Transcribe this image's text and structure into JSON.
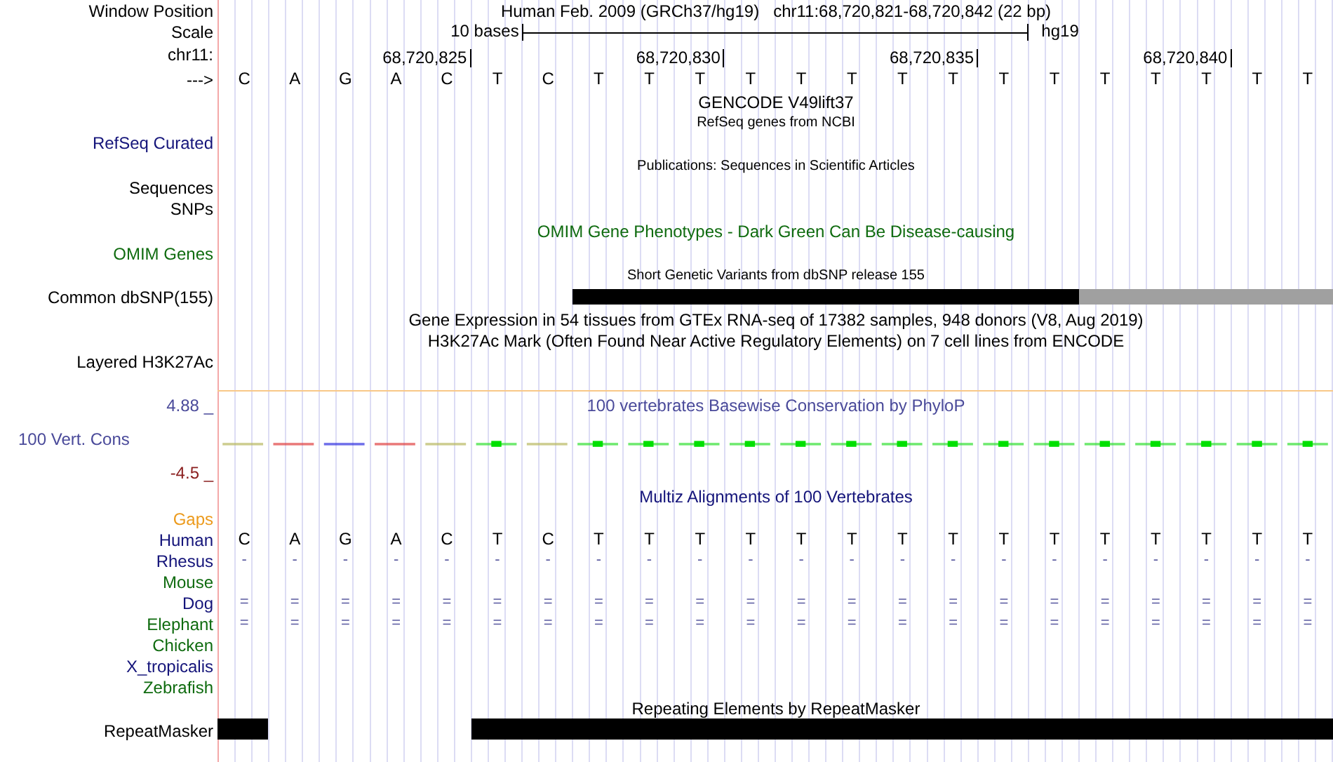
{
  "window_position": {
    "label": "Window Position",
    "text": "Human Feb. 2009 (GRCh37/hg19)   chr11:68,720,821-68,720,842 (22 bp)"
  },
  "scale": {
    "label": "Scale",
    "bar_label": "10 bases",
    "assembly": "hg19"
  },
  "ruler": {
    "label": "chr11:",
    "ticks": [
      "68,720,825",
      "68,720,830",
      "68,720,835",
      "68,720,840"
    ]
  },
  "sequence": {
    "label": "--->",
    "bases": [
      "C",
      "A",
      "G",
      "A",
      "C",
      "T",
      "C",
      "T",
      "T",
      "T",
      "T",
      "T",
      "T",
      "T",
      "T",
      "T",
      "T",
      "T",
      "T",
      "T",
      "T",
      "T"
    ]
  },
  "gencode": {
    "title": "GENCODE V49lift37"
  },
  "refseq": {
    "title": "RefSeq genes from NCBI",
    "label": "RefSeq Curated"
  },
  "publications": {
    "title": "Publications: Sequences in Scientific Articles",
    "label": "Sequences"
  },
  "snps": {
    "label": "SNPs"
  },
  "omim": {
    "title": "OMIM Gene Phenotypes - Dark Green Can Be Disease-causing",
    "label": "OMIM Genes"
  },
  "dbsnp": {
    "title": "Short Genetic Variants from dbSNP release 155",
    "label": "Common dbSNP(155)"
  },
  "gtex": {
    "title": "Gene Expression in 54 tissues from GTEx RNA-seq of 17382 samples, 948 donors (V8, Aug 2019)"
  },
  "h3k27ac": {
    "title": "H3K27Ac Mark (Often Found Near Active Regulatory Elements) on 7 cell lines from ENCODE",
    "label": "Layered H3K27Ac"
  },
  "conservation": {
    "title": "100 vertebrates Basewise Conservation by PhyloP",
    "label": "100 Vert. Cons",
    "max": "4.88 _",
    "min": "-4.5 _"
  },
  "multiz": {
    "title": "Multiz Alignments of 100 Vertebrates",
    "gaps_label": "Gaps",
    "species": [
      {
        "name": "Human",
        "color": "#14147a",
        "alignment": [
          "C",
          "A",
          "G",
          "A",
          "C",
          "T",
          "C",
          "T",
          "T",
          "T",
          "T",
          "T",
          "T",
          "T",
          "T",
          "T",
          "T",
          "T",
          "T",
          "T",
          "T",
          "T"
        ]
      },
      {
        "name": "Rhesus",
        "color": "#14147a",
        "alignment": [
          "-",
          "-",
          "-",
          "-",
          "-",
          "-",
          "-",
          "-",
          "-",
          "-",
          "-",
          "-",
          "-",
          "-",
          "-",
          "-",
          "-",
          "-",
          "-",
          "-",
          "-",
          "-"
        ]
      },
      {
        "name": "Mouse",
        "color": "#0f6b0f"
      },
      {
        "name": "Dog",
        "color": "#14147a",
        "alignment": [
          "=",
          "=",
          "=",
          "=",
          "=",
          "=",
          "=",
          "=",
          "=",
          "=",
          "=",
          "=",
          "=",
          "=",
          "=",
          "=",
          "=",
          "=",
          "=",
          "=",
          "=",
          "="
        ]
      },
      {
        "name": "Elephant",
        "color": "#0f6b0f",
        "alignment": [
          "=",
          "=",
          "=",
          "=",
          "=",
          "=",
          "=",
          "=",
          "=",
          "=",
          "=",
          "=",
          "=",
          "=",
          "=",
          "=",
          "=",
          "=",
          "=",
          "=",
          "=",
          "="
        ]
      },
      {
        "name": "Chicken",
        "color": "#0f6b0f"
      },
      {
        "name": "X_tropicalis",
        "color": "#14147a"
      },
      {
        "name": "Zebrafish",
        "color": "#0f6b0f"
      }
    ]
  },
  "repeatmasker": {
    "title": "Repeating Elements by RepeatMasker",
    "label": "RepeatMasker"
  }
}
